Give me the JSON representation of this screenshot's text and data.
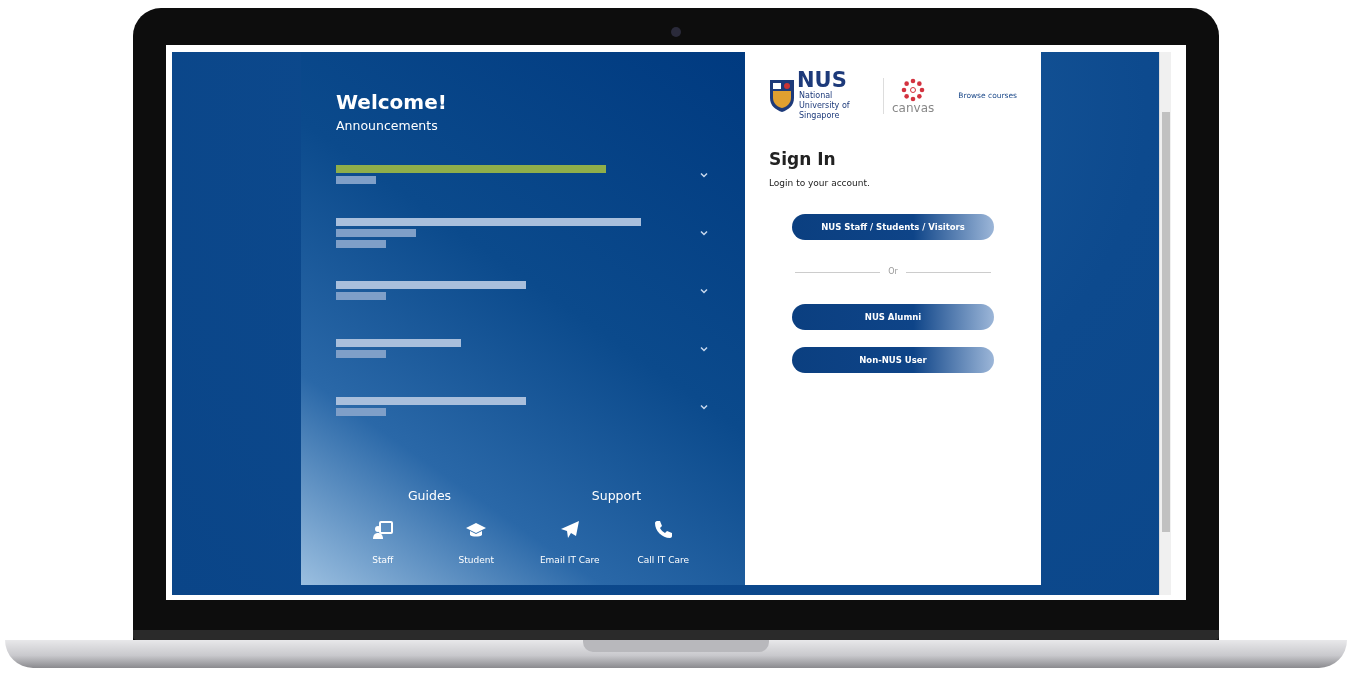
{
  "welcome": {
    "title": "Welcome!",
    "subtitle": "Announcements"
  },
  "announcements": [
    {
      "color": "#8fae4a",
      "expanded": false
    },
    {
      "color": "#a9bfdc",
      "expanded": false
    },
    {
      "color": "#a9bfdc",
      "expanded": false
    },
    {
      "color": "#a9bfdc",
      "expanded": false
    },
    {
      "color": "#a9bfdc",
      "expanded": false
    }
  ],
  "sections": [
    {
      "title": "Guides",
      "links": [
        {
          "kind": "staff",
          "label": "Staff"
        },
        {
          "kind": "student",
          "label": "Student"
        }
      ]
    },
    {
      "title": "Support",
      "links": [
        {
          "kind": "email",
          "label": "Email IT Care"
        },
        {
          "kind": "call",
          "label": "Call IT Care"
        }
      ]
    }
  ],
  "header": {
    "logo_name": "NUS",
    "logo_sub": "National University of Singapore",
    "partner": "canvas",
    "browse": "Browse courses"
  },
  "signin": {
    "title": "Sign In",
    "subtitle": "Login to your account.",
    "divider": "Or",
    "buttons": [
      "NUS Staff / Students / Visitors",
      "NUS Alumni",
      "Non-NUS User"
    ]
  }
}
